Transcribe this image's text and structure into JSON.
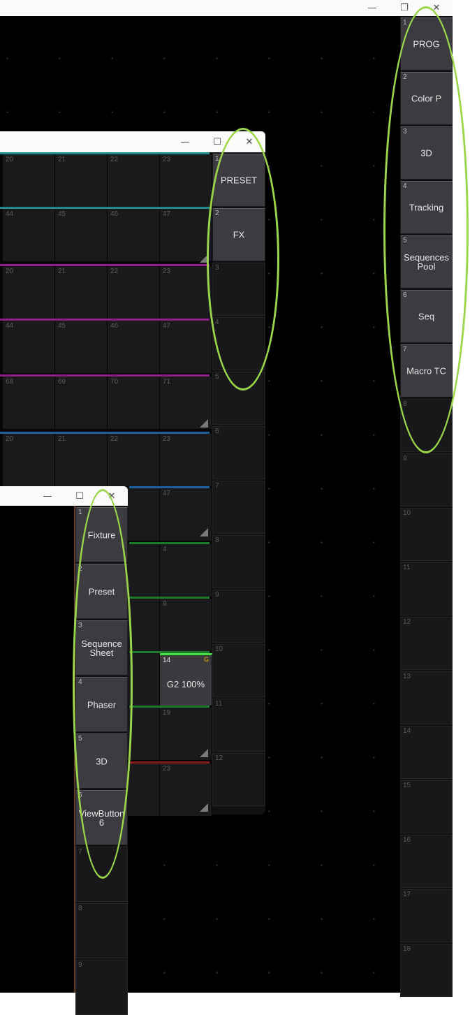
{
  "window_controls": {
    "minimize": "—",
    "maximize": "☐",
    "restore": "❐",
    "close": "✕"
  },
  "right_pool": [
    {
      "num": "1",
      "label": "PROG"
    },
    {
      "num": "2",
      "label": "Color P"
    },
    {
      "num": "3",
      "label": "3D"
    },
    {
      "num": "4",
      "label": "Tracking"
    },
    {
      "num": "5",
      "label": "Sequences\nPool"
    },
    {
      "num": "6",
      "label": "Seq"
    },
    {
      "num": "7",
      "label": "Macro TC"
    },
    {
      "num": "8",
      "label": ""
    },
    {
      "num": "9",
      "label": ""
    },
    {
      "num": "10",
      "label": ""
    },
    {
      "num": "11",
      "label": ""
    },
    {
      "num": "12",
      "label": ""
    },
    {
      "num": "13",
      "label": ""
    },
    {
      "num": "14",
      "label": ""
    },
    {
      "num": "15",
      "label": ""
    },
    {
      "num": "16",
      "label": ""
    },
    {
      "num": "17",
      "label": ""
    },
    {
      "num": "18",
      "label": ""
    }
  ],
  "mid_pool": [
    {
      "num": "1",
      "label": "PRESET"
    },
    {
      "num": "2",
      "label": "FX"
    },
    {
      "num": "3",
      "label": ""
    },
    {
      "num": "4",
      "label": ""
    },
    {
      "num": "5",
      "label": ""
    },
    {
      "num": "6",
      "label": ""
    },
    {
      "num": "7",
      "label": ""
    },
    {
      "num": "8",
      "label": ""
    },
    {
      "num": "9",
      "label": ""
    },
    {
      "num": "10",
      "label": ""
    },
    {
      "num": "11",
      "label": ""
    },
    {
      "num": "12",
      "label": ""
    }
  ],
  "front_pool": [
    {
      "num": "1",
      "label": "Fixture"
    },
    {
      "num": "2",
      "label": "Preset"
    },
    {
      "num": "3",
      "label": "Sequence\nSheet"
    },
    {
      "num": "4",
      "label": "Phaser"
    },
    {
      "num": "5",
      "label": "3D"
    },
    {
      "num": "6",
      "label": "ViewButton\n6"
    },
    {
      "num": "7",
      "label": ""
    },
    {
      "num": "8",
      "label": ""
    },
    {
      "num": "9",
      "label": ""
    }
  ],
  "grid_rows": [
    {
      "cells": [
        "20",
        "21",
        "22",
        "23"
      ],
      "line_color": "#1f8a8c"
    },
    {
      "cells": [
        "44",
        "45",
        "46",
        "47"
      ],
      "line_color": "#1f8a8c"
    },
    {
      "cells": [
        "20",
        "21",
        "22",
        "23"
      ],
      "line_color": "#8c1f8c"
    },
    {
      "cells": [
        "44",
        "45",
        "46",
        "47"
      ],
      "line_color": "#8c1f8c"
    },
    {
      "cells": [
        "68",
        "69",
        "70",
        "71"
      ],
      "line_color": "#8c1f8c"
    },
    {
      "cells": [
        "20",
        "21",
        "22",
        "23"
      ],
      "line_color": "#1f5f9c"
    },
    {
      "cells": [
        "",
        "47"
      ],
      "line_color": "#1f5f9c"
    },
    {
      "cells": [
        "",
        "4"
      ],
      "line_color": "#1d7a2a"
    },
    {
      "cells": [
        "",
        "9"
      ],
      "line_color": "#1d7a2a"
    },
    {
      "cells": [
        "",
        "14"
      ],
      "line_color": "#1d7a2a"
    },
    {
      "cells": [
        "",
        "19"
      ],
      "line_color": "#1d7a2a"
    },
    {
      "cells": [
        "",
        "23"
      ],
      "line_color": "#8a1a1a"
    }
  ],
  "active_group": {
    "num": "14",
    "label": "G2 100%",
    "badge": "G",
    "accent": "#3ee03e"
  }
}
